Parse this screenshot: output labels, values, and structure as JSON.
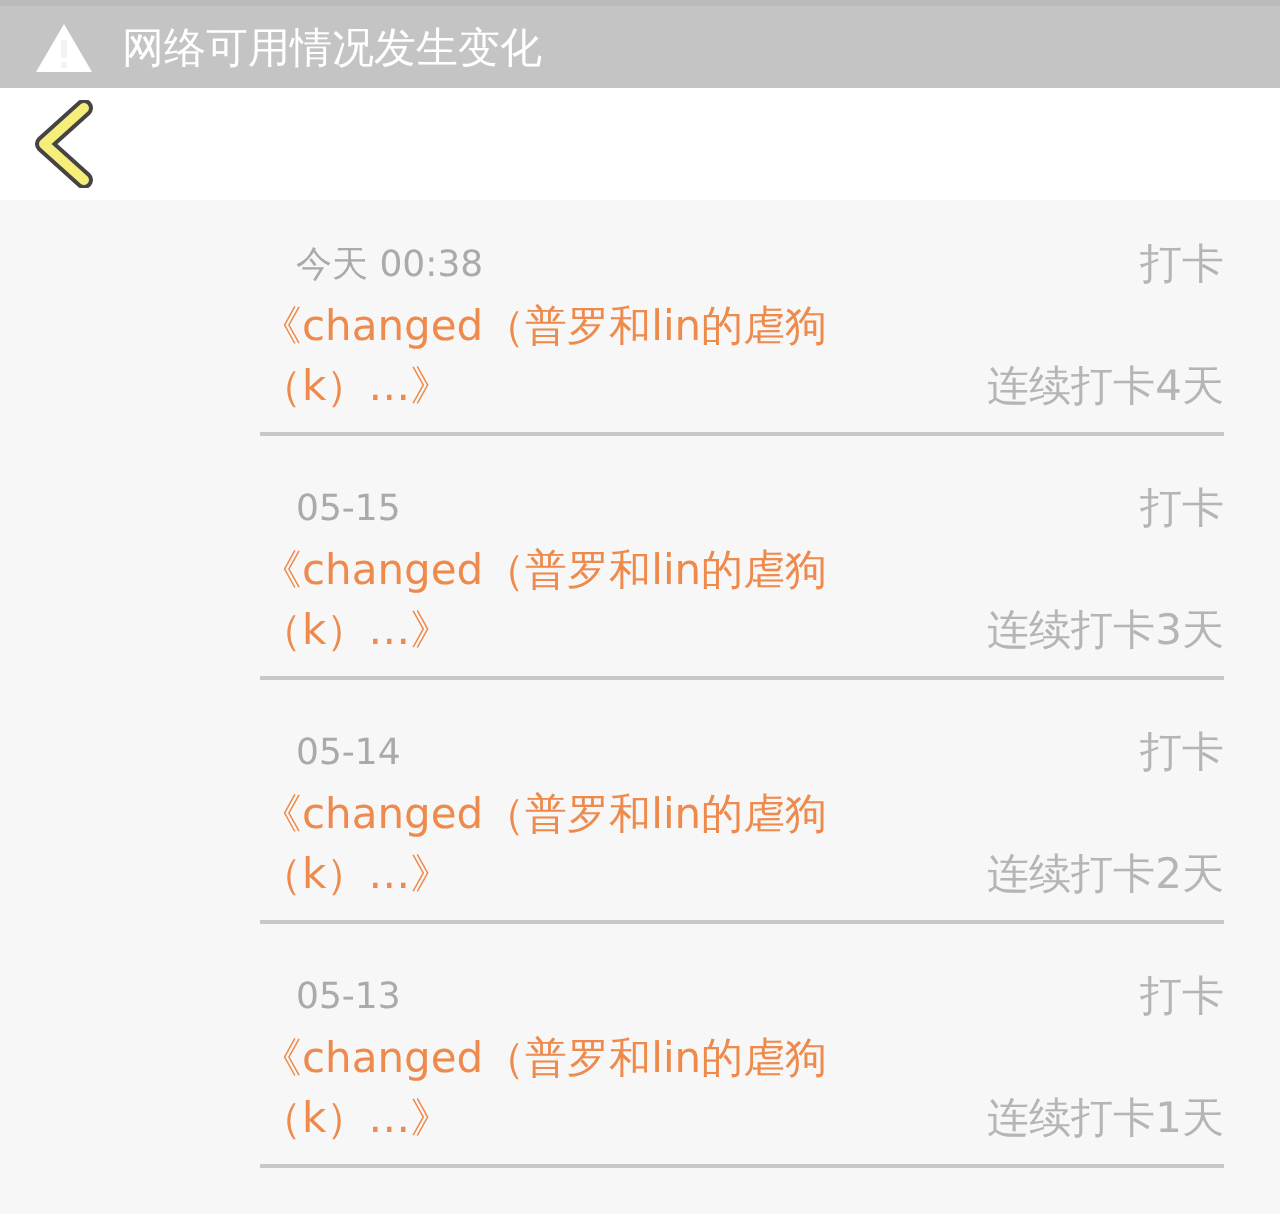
{
  "notice": {
    "text": "网络可用情况发生变化"
  },
  "entries": [
    {
      "date": "今天 00:38",
      "action": "打卡",
      "title": "《changed（普罗和lin的虐狗（k）…》",
      "streak": "连续打卡4天"
    },
    {
      "date": "05-15",
      "action": "打卡",
      "title": "《changed（普罗和lin的虐狗（k）…》",
      "streak": "连续打卡3天"
    },
    {
      "date": "05-14",
      "action": "打卡",
      "title": "《changed（普罗和lin的虐狗（k）…》",
      "streak": "连续打卡2天"
    },
    {
      "date": "05-13",
      "action": "打卡",
      "title": "《changed（普罗和lin的虐狗（k）…》",
      "streak": "连续打卡1天"
    }
  ]
}
